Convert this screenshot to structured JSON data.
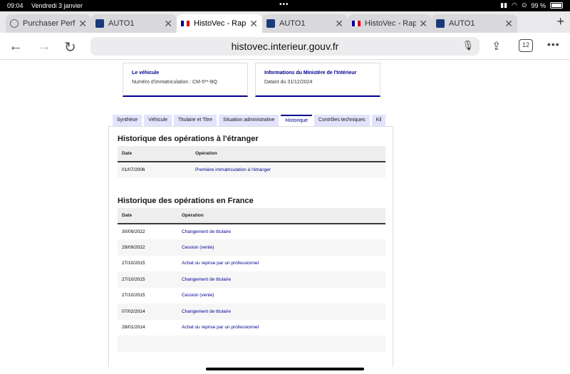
{
  "status": {
    "time": "09:04",
    "date": "Vendredi 3 janvier",
    "battery": "99 %"
  },
  "tabs": [
    {
      "label": "Purchaser Perf",
      "active": false
    },
    {
      "label": "AUTO1",
      "active": false
    },
    {
      "label": "HistoVec - Rap",
      "active": true
    },
    {
      "label": "AUTO1",
      "active": false
    },
    {
      "label": "HistoVec - Rap",
      "active": false
    },
    {
      "label": "AUTO1",
      "active": false
    }
  ],
  "toolbar": {
    "url": "histovec.interieur.gouv.fr",
    "tab_count": "12"
  },
  "cards": {
    "vehicle": {
      "title": "Le véhicule",
      "value": "Numéro d'immatriculation : CM-5**-BQ"
    },
    "ministry": {
      "title": "Informations du Ministère de l'Intérieur",
      "value": "Datant du 31/12/2024"
    }
  },
  "page_tabs": [
    "Synthèse",
    "Véhicule",
    "Titulaire et Titre",
    "Situation administrative",
    "Historique",
    "Contrôles techniques",
    "Kil"
  ],
  "foreign": {
    "title": "Historique des opérations à l'étranger",
    "headers": [
      "Date",
      "Opération"
    ],
    "rows": [
      [
        "01/07/2006",
        "Première immatriculation à l'étranger"
      ]
    ]
  },
  "france": {
    "title": "Historique des opérations en France",
    "headers": [
      "Date",
      "Opération"
    ],
    "rows": [
      [
        "30/09/2022",
        "Changement de titulaire"
      ],
      [
        "29/09/2022",
        "Cession (vente)"
      ],
      [
        "27/10/2015",
        "Achat ou reprise par un professionnel"
      ],
      [
        "27/10/2015",
        "Changement de titulaire"
      ],
      [
        "27/10/2015",
        "Cession (vente)"
      ],
      [
        "07/02/2014",
        "Changement de titulaire"
      ],
      [
        "28/01/2014",
        "Achat ou reprise par un professionnel"
      ]
    ]
  }
}
